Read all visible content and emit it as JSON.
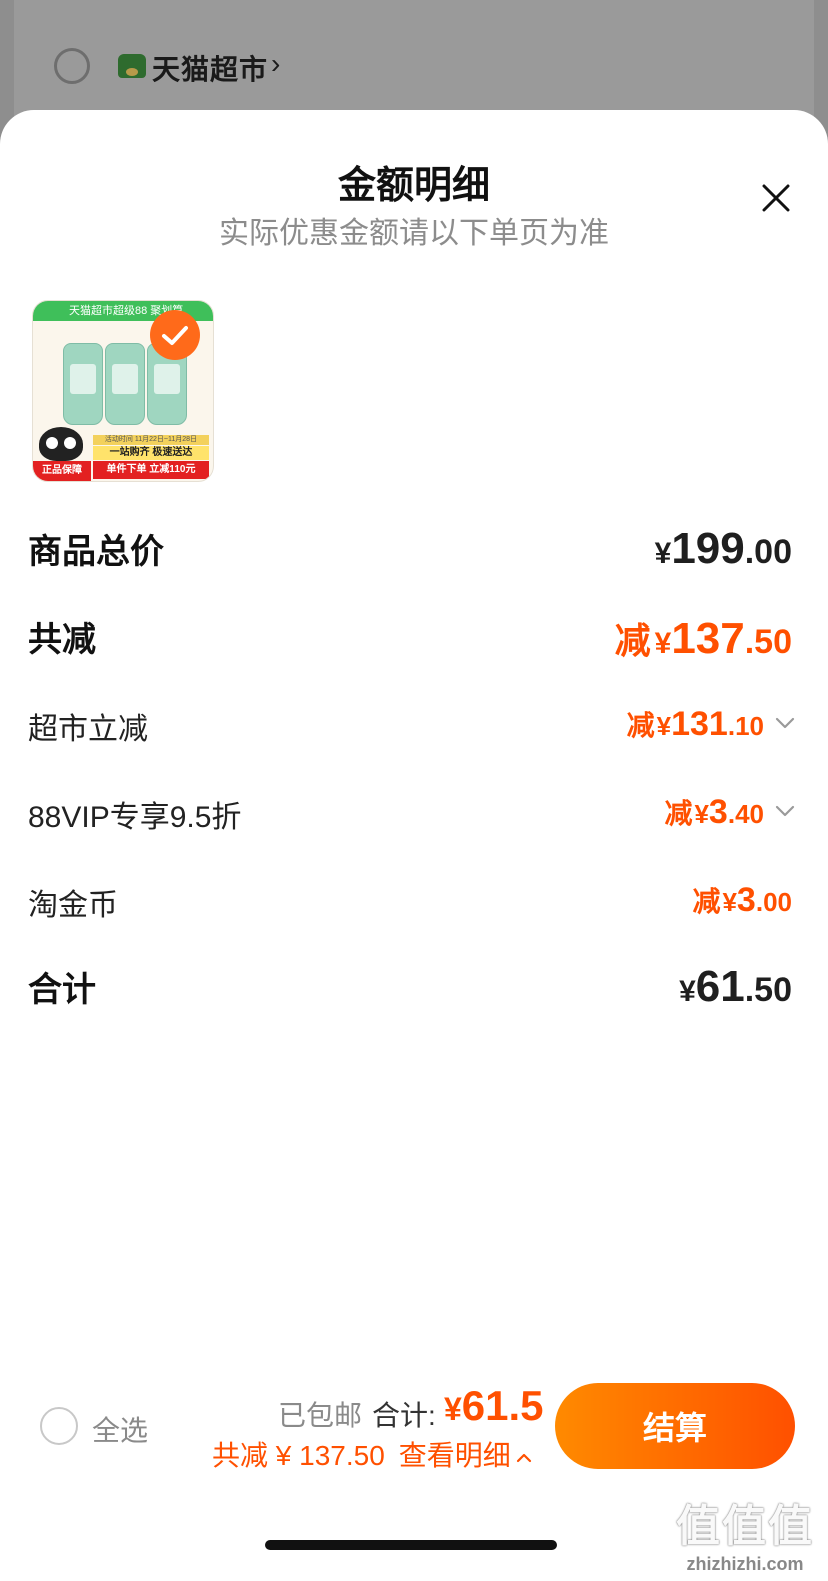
{
  "store": {
    "name": "天猫超市",
    "chevron": "›"
  },
  "sheet": {
    "title": "金额明细",
    "subtitle": "实际优惠金额请以下单页为准"
  },
  "product": {
    "top_banner": "天猫超市超级88  聚划算",
    "strip_small": "活动时间 11月22日~11月28日",
    "strip_mid": "一站购齐 极速送达",
    "strip_red": "单件下单 立减110元",
    "badge": "正品保障"
  },
  "rows": {
    "goods_total": {
      "label": "商品总价",
      "currency": "¥",
      "int": "199",
      "dec": ".00"
    },
    "total_discount": {
      "label": "共减",
      "prefix": "减",
      "currency": "¥",
      "int": "137",
      "dec": ".50"
    },
    "supermarket_discount": {
      "label": "超市立减",
      "prefix": "减",
      "currency": "¥",
      "int": "131",
      "dec": ".10"
    },
    "vip_discount": {
      "label": "88VIP专享9.5折",
      "prefix": "减",
      "currency": "¥",
      "int": "3",
      "dec": ".40"
    },
    "coins": {
      "label": "淘金币",
      "prefix": "减",
      "currency": "¥",
      "int": "3",
      "dec": ".00"
    },
    "sum": {
      "label": "合计",
      "currency": "¥",
      "int": "61",
      "dec": ".50"
    }
  },
  "footer": {
    "select_all": "全选",
    "shipping": "已包邮",
    "total_label": "合计:",
    "total_currency": "¥",
    "total_value": "61.5",
    "saving": "共减 ¥ 137.50",
    "view_detail": "查看明细",
    "checkout": "结算"
  },
  "watermark": {
    "big": "值值值",
    "small": "zhizhizhi.com"
  },
  "colors": {
    "accent": "#ff5000",
    "accent_light": "#ff8a00"
  }
}
